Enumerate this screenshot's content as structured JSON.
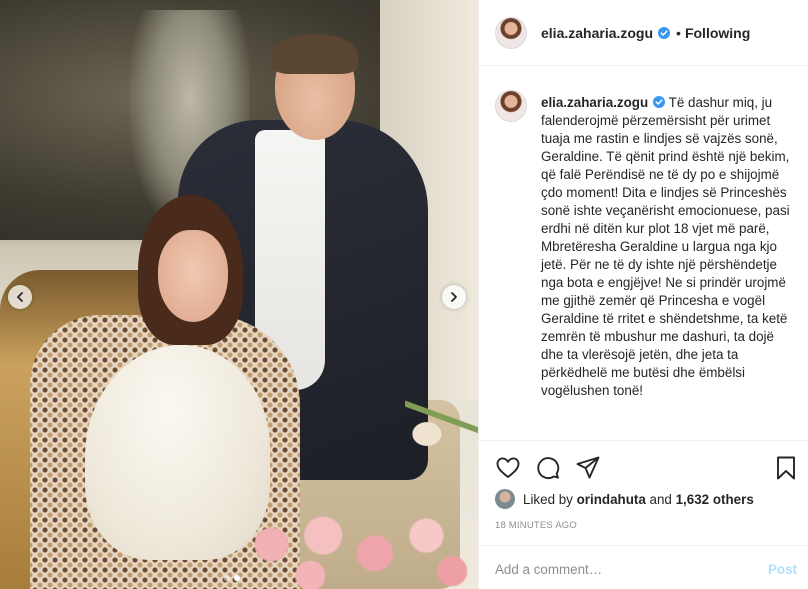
{
  "post": {
    "username": "elia.zaharia.zogu",
    "follow_separator": "•",
    "follow_state": "Following",
    "caption": "Të dashur miq, ju falenderojmë përzemërsisht për urimet tuaja me rastin e lindjes së vajzës sonë, Geraldine. Të qënit prind është një bekim, që falë Perëndisë ne të dy po e shijojmë çdo moment! Dita e lindjes së Princeshës sonë ishte veçanërisht emocionuese, pasi erdhi në ditën kur plot 18 vjet më parë, Mbretëresha Geraldine u largua nga kjo jetë. Për ne të dy ishte një përshëndetje nga bota e engjëjve! Ne si prindër urojmë me gjithë zemër që Princesha e vogël Geraldine të rritet e shëndetshme, ta ketë zemrën të mbushur me dashuri, ta dojë dhe ta vlerësojë jetën, dhe jeta ta përkëdhelë me butësi dhe ëmbëlsi vogëlushen tonë!",
    "likes_prefix": "Liked by",
    "liked_by_user": "orindahuta",
    "likes_and": "and",
    "likes_others": "1,632 others",
    "timestamp": "18 MINUTES AGO",
    "comment_placeholder": "Add a comment…",
    "post_button": "Post"
  },
  "carousel": {
    "slide_count": 2,
    "active_slide": 1
  },
  "colors": {
    "verified_blue": "#3897f0",
    "post_button_disabled": "#b2dffc",
    "secondary_text": "#8e8e8e"
  },
  "icons": [
    "heart-icon",
    "comment-icon",
    "share-icon",
    "bookmark-icon",
    "chevron-left-icon",
    "chevron-right-icon",
    "verified-badge-icon"
  ]
}
